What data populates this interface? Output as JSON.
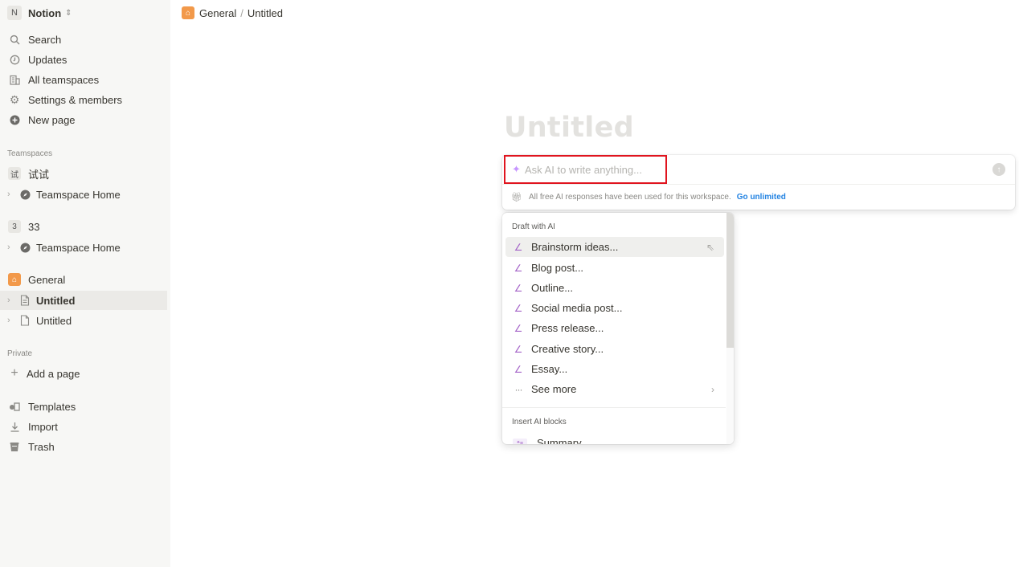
{
  "sidebar": {
    "workspace": {
      "badge": "N",
      "name": "Notion"
    },
    "top_items": [
      {
        "icon": "search-icon",
        "label": "Search"
      },
      {
        "icon": "clock-icon",
        "label": "Updates"
      },
      {
        "icon": "building-icon",
        "label": "All teamspaces"
      },
      {
        "icon": "gear-icon",
        "label": "Settings & members"
      },
      {
        "icon": "plus-circle-icon",
        "label": "New page"
      }
    ],
    "teamspaces_label": "Teamspaces",
    "teamspaces": [
      {
        "badge": "试",
        "name": "试试",
        "home_label": "Teamspace Home"
      },
      {
        "badge": "3",
        "name": "33",
        "home_label": "Teamspace Home"
      }
    ],
    "general": {
      "name": "General",
      "pages": [
        {
          "label": "Untitled",
          "active": true
        },
        {
          "label": "Untitled",
          "active": false
        }
      ]
    },
    "private_label": "Private",
    "add_page_label": "Add a page",
    "bottom_items": [
      {
        "icon": "templates-icon",
        "label": "Templates"
      },
      {
        "icon": "import-icon",
        "label": "Import"
      },
      {
        "icon": "trash-icon",
        "label": "Trash"
      }
    ]
  },
  "breadcrumb": {
    "workspace": "General",
    "separator": "/",
    "page": "Untitled"
  },
  "page": {
    "title": "Untitled"
  },
  "ai": {
    "placeholder": "Ask AI to write anything...",
    "notice": "All free AI responses have been used for this workspace.",
    "upgrade_link": "Go unlimited"
  },
  "menu": {
    "draft_heading": "Draft with AI",
    "draft_items": [
      "Brainstorm ideas...",
      "Blog post...",
      "Outline...",
      "Social media post...",
      "Press release...",
      "Creative story...",
      "Essay..."
    ],
    "see_more": "See more",
    "insert_heading": "Insert AI blocks",
    "insert_items": [
      {
        "badge": "❝≡",
        "label": "Summary"
      }
    ]
  },
  "colors": {
    "sidebar_bg": "#f7f7f5",
    "accent_link": "#2383e2",
    "ai_purple": "#a565c8",
    "highlight_border": "#e0141e",
    "general_icon": "#f2994a"
  }
}
